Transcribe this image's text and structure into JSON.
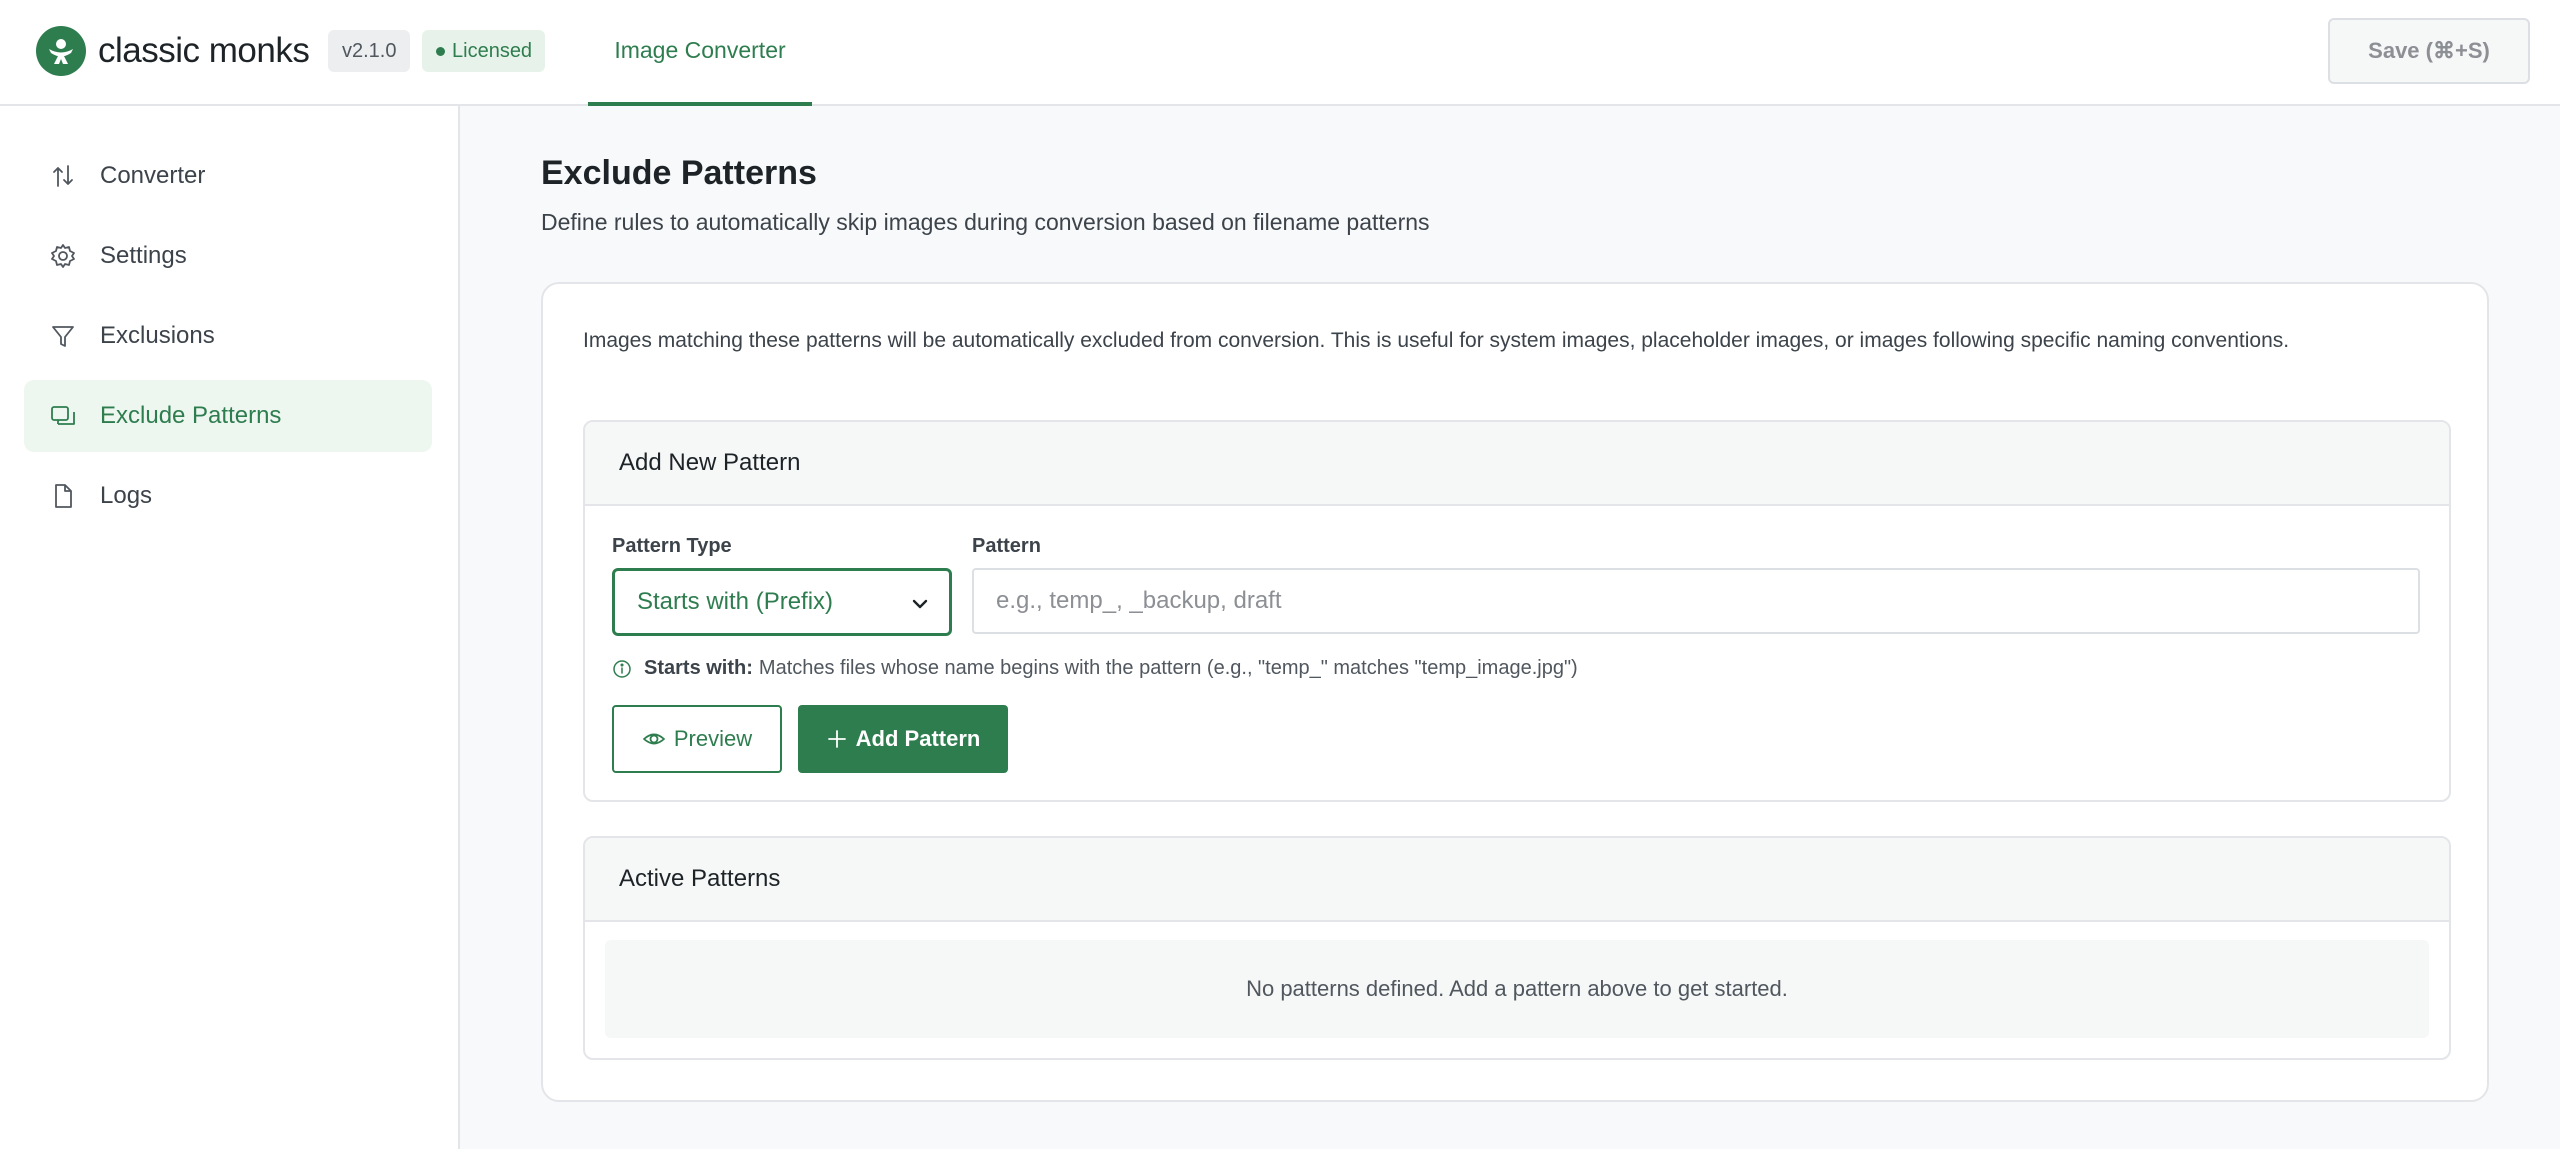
{
  "header": {
    "brand_name": "classic monks",
    "version": "v2.1.0",
    "license_status": "Licensed",
    "active_tab": "Image Converter",
    "save_button": "Save (⌘+S)"
  },
  "sidebar": {
    "items": [
      {
        "label": "Converter",
        "icon": "arrows-up-down-icon",
        "active": false
      },
      {
        "label": "Settings",
        "icon": "gear-icon",
        "active": false
      },
      {
        "label": "Exclusions",
        "icon": "filter-icon",
        "active": false
      },
      {
        "label": "Exclude Patterns",
        "icon": "copy-icon",
        "active": true
      },
      {
        "label": "Logs",
        "icon": "file-icon",
        "active": false
      }
    ]
  },
  "main": {
    "title": "Exclude Patterns",
    "subtitle": "Define rules to automatically skip images during conversion based on filename patterns",
    "description": "Images matching these patterns will be automatically excluded from conversion. This is useful for system images, placeholder images, or images following specific naming conventions.",
    "add_panel": {
      "title": "Add New Pattern",
      "pattern_type_label": "Pattern Type",
      "pattern_type_value": "Starts with (Prefix)",
      "pattern_label": "Pattern",
      "pattern_value": "",
      "pattern_placeholder": "e.g., temp_, _backup, draft",
      "hint_label": "Starts with:",
      "hint_text": "Matches files whose name begins with the pattern (e.g., \"temp_\" matches \"temp_image.jpg\")",
      "preview_button": "Preview",
      "add_button": "Add Pattern"
    },
    "active_panel": {
      "title": "Active Patterns",
      "empty_message": "No patterns defined. Add a pattern above to get started."
    }
  },
  "colors": {
    "accent": "#2e7d4f",
    "accent_light": "#eef6f0",
    "border": "#e3e5e8",
    "background": "#f8f9fa"
  }
}
